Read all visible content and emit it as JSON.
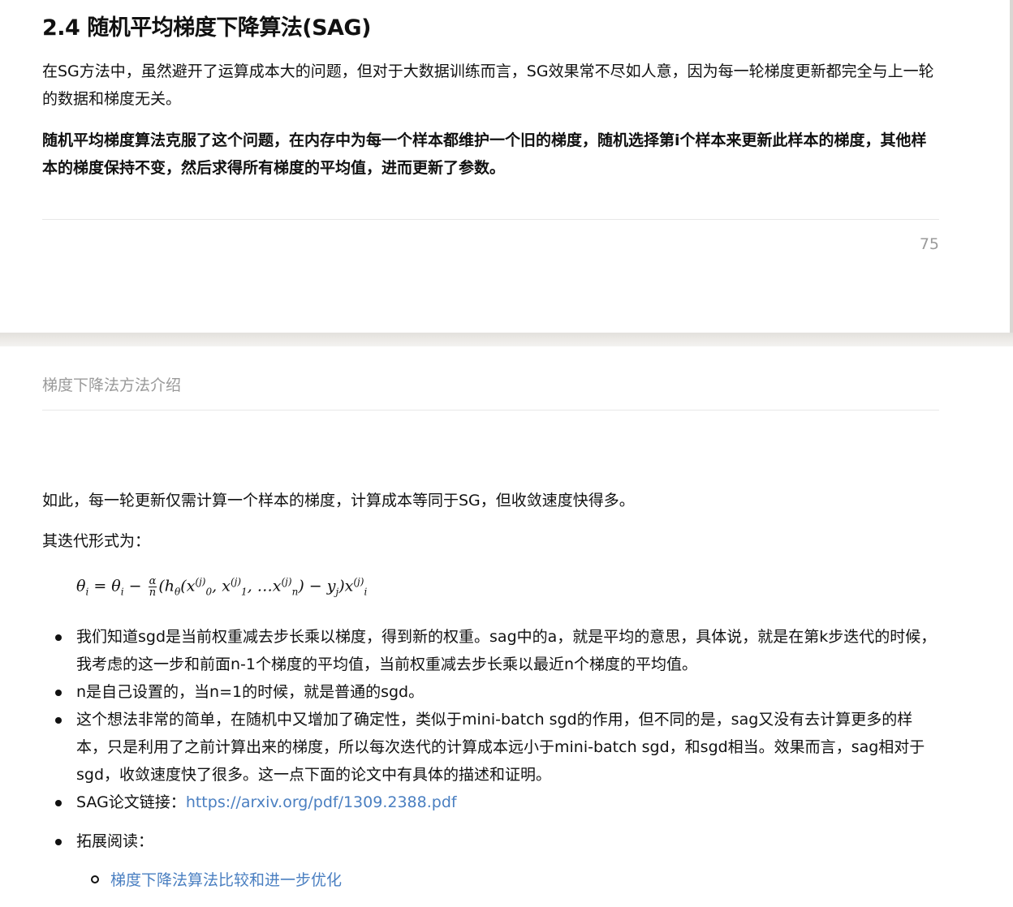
{
  "page1": {
    "heading": "2.4 随机平均梯度下降算法(SAG)",
    "paragraph1": "在SG方法中，虽然避开了运算成本大的问题，但对于大数据训练而言，SG效果常不尽如人意，因为每一轮梯度更新都完全与上一轮的数据和梯度无关。",
    "paragraph2": "随机平均梯度算法克服了这个问题，在内存中为每一个样本都维护一个旧的梯度，随机选择第i个样本来更新此样本的梯度，其他样本的梯度保持不变，然后求得所有梯度的平均值，进而更新了参数。",
    "page_number": "75"
  },
  "page2": {
    "running_header": "梯度下降法方法介绍",
    "paragraph1": "如此，每一轮更新仅需计算一个样本的梯度，计算成本等同于SG，但收敛速度快得多。",
    "paragraph2": "其迭代形式为：",
    "formula": {
      "lhs": "θ",
      "sub_i": "i",
      "equals": " = ",
      "minus": " − ",
      "alpha": "α",
      "n": "n",
      "h": "(h",
      "theta_sub": "θ",
      "x": "x",
      "j": "(j)",
      "zero": "0",
      "one": "1",
      "dots": ", …x",
      "close": ") − y",
      "yj": "j",
      "tail": ")x"
    },
    "bullets": [
      "我们知道sgd是当前权重减去步长乘以梯度，得到新的权重。sag中的a，就是平均的意思，具体说，就是在第k步迭代的时候，我考虑的这一步和前面n-1个梯度的平均值，当前权重减去步长乘以最近n个梯度的平均值。",
      "n是自己设置的，当n=1的时候，就是普通的sgd。",
      "这个想法非常的简单，在随机中又增加了确定性，类似于mini-batch sgd的作用，但不同的是，sag又没有去计算更多的样本，只是利用了之前计算出来的梯度，所以每次迭代的计算成本远小于mini-batch sgd，和sgd相当。效果而言，sag相对于sgd，收敛速度快了很多。这一点下面的论文中有具体的描述和证明。"
    ],
    "sag_link_label": "SAG论文链接：",
    "sag_link_url": "https://arxiv.org/pdf/1309.2388.pdf",
    "further_reading_label": "拓展阅读：",
    "further_reading_item": "梯度下降法算法比较和进一步优化"
  },
  "colors": {
    "link": "#4a7fc1",
    "muted_text": "#9a9a9a",
    "page_gap": "#e2e0dc"
  }
}
